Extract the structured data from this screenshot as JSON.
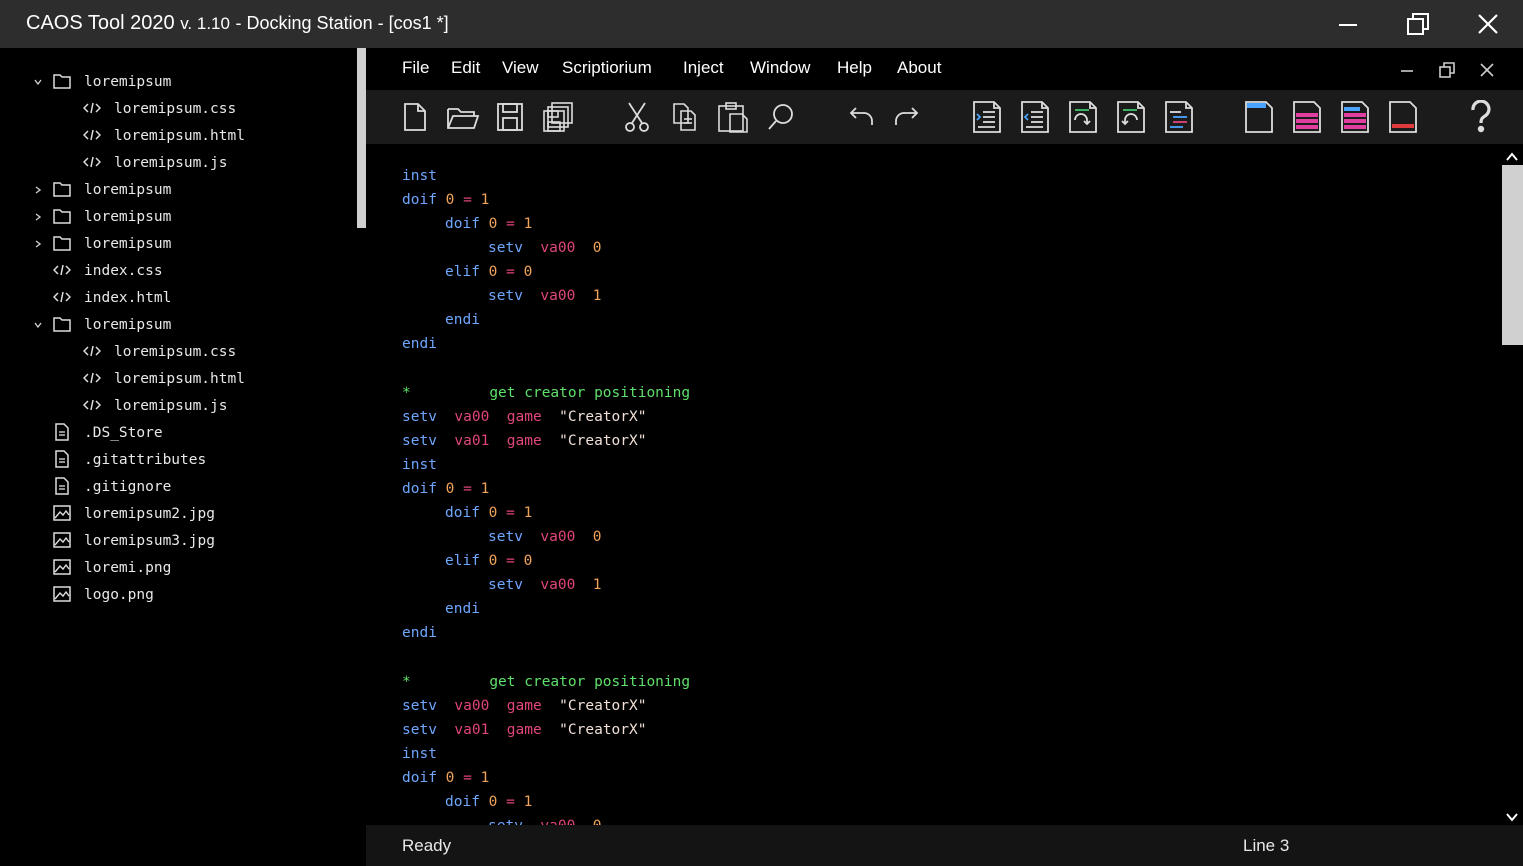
{
  "window": {
    "app_name": "CAOS Tool 2020",
    "version": "v. 1.10",
    "doc_title": " - Docking Station - [cos1 *]"
  },
  "sidebar": {
    "items": [
      {
        "label": "loremipsum",
        "type": "folder",
        "expanded": true
      },
      {
        "label": "loremipsum.css",
        "type": "code"
      },
      {
        "label": "loremipsum.html",
        "type": "code"
      },
      {
        "label": "loremipsum.js",
        "type": "code"
      },
      {
        "label": "loremipsum",
        "type": "folder",
        "expanded": false
      },
      {
        "label": "loremipsum",
        "type": "folder",
        "expanded": false
      },
      {
        "label": "loremipsum",
        "type": "folder",
        "expanded": false
      },
      {
        "label": "index.css",
        "type": "code"
      },
      {
        "label": "index.html",
        "type": "code"
      },
      {
        "label": "loremipsum",
        "type": "folder",
        "expanded": true
      },
      {
        "label": "loremipsum.css",
        "type": "code"
      },
      {
        "label": "loremipsum.html",
        "type": "code"
      },
      {
        "label": "loremipsum.js",
        "type": "code"
      },
      {
        "label": ".DS_Store",
        "type": "file"
      },
      {
        "label": ".gitattributes",
        "type": "file"
      },
      {
        "label": ".gitignore",
        "type": "file"
      },
      {
        "label": "loremipsum2.jpg",
        "type": "image"
      },
      {
        "label": "loremipsum3.jpg",
        "type": "image"
      },
      {
        "label": "loremi.png",
        "type": "image"
      },
      {
        "label": "logo.png",
        "type": "image"
      }
    ]
  },
  "menu": [
    "File",
    "Edit",
    "View",
    "Scriptiorium",
    "Inject",
    "Window",
    "Help",
    "About"
  ],
  "toolbar_icons": [
    "new-file-icon",
    "open-folder-icon",
    "save-icon",
    "save-all-icon",
    "cut-icon",
    "copy-icon",
    "paste-icon",
    "search-icon",
    "undo-icon",
    "redo-icon",
    "indent-icon",
    "outdent-icon",
    "comment-icon",
    "uncomment-icon",
    "format-icon",
    "blank-page-icon",
    "pink-lines-icon",
    "mixed-lines-icon",
    "red-line-icon",
    "help-icon"
  ],
  "colors": {
    "keyword": "#6fa7ff",
    "variable": "#e0457b",
    "number": "#f0a35a",
    "comment": "#5fe06a",
    "string": "#f0e0d8"
  },
  "code": {
    "kw_inst": "inst",
    "kw_doif": "doif",
    "kw_elif": "elif",
    "kw_endi": "endi",
    "kw_setv": "setv",
    "var_va00": "va00",
    "var_va01": "va01",
    "var_game": "game",
    "num_0": "0",
    "num_1": "1",
    "op_eq": "=",
    "str_creator": "\"CreatorX\"",
    "comment_star": "*",
    "comment_text": "get creator positioning"
  },
  "status": {
    "left": "Ready",
    "right": "Line 3"
  }
}
